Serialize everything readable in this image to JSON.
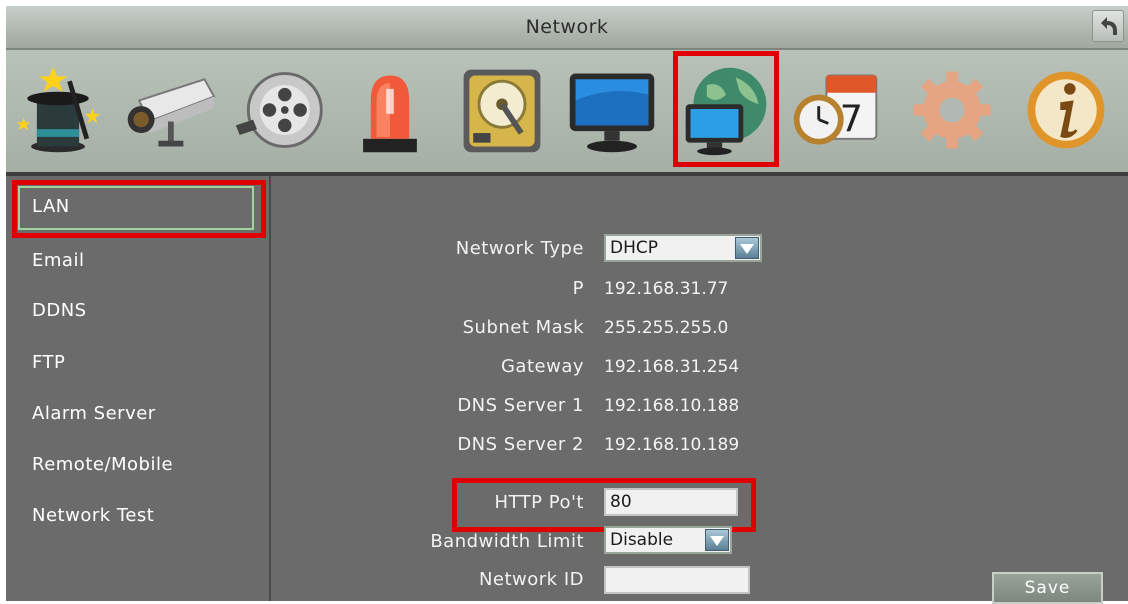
{
  "window": {
    "title": "Network"
  },
  "toolbar": {
    "icons": [
      "wizard-icon",
      "camera-icon",
      "record-icon",
      "alarm-icon",
      "storage-icon",
      "display-icon",
      "network-icon",
      "schedule-icon",
      "settings-icon",
      "info-icon"
    ],
    "selected": "network-icon"
  },
  "sidebar": {
    "items": [
      {
        "label": "LAN"
      },
      {
        "label": "Email"
      },
      {
        "label": "DDNS"
      },
      {
        "label": "FTP"
      },
      {
        "label": "Alarm Server"
      },
      {
        "label": "Remote/Mobile"
      },
      {
        "label": "Network Test"
      }
    ],
    "selected": "LAN"
  },
  "lan": {
    "network_type": {
      "label": "Network Type",
      "value": "DHCP"
    },
    "ip": {
      "label": "P",
      "value": "192.168.31.77"
    },
    "subnet": {
      "label": "Subnet Mask",
      "value": "255.255.255.0"
    },
    "gateway": {
      "label": "Gateway",
      "value": "192.168.31.254"
    },
    "dns1": {
      "label": "DNS Server 1",
      "value": "192.168.10.188"
    },
    "dns2": {
      "label": "DNS Server 2",
      "value": "192.168.10.189"
    },
    "http_port": {
      "label": "HTTP Po't",
      "value": "80"
    },
    "bandwidth": {
      "label": "Bandwidth Limit",
      "value": "Disable"
    },
    "network_id": {
      "label": "Network ID",
      "value": ""
    }
  },
  "actions": {
    "save": "Save"
  },
  "colors": {
    "highlight": "#e00000",
    "panel": "#6b6b6b",
    "toolbar": "#aeb6ae"
  }
}
